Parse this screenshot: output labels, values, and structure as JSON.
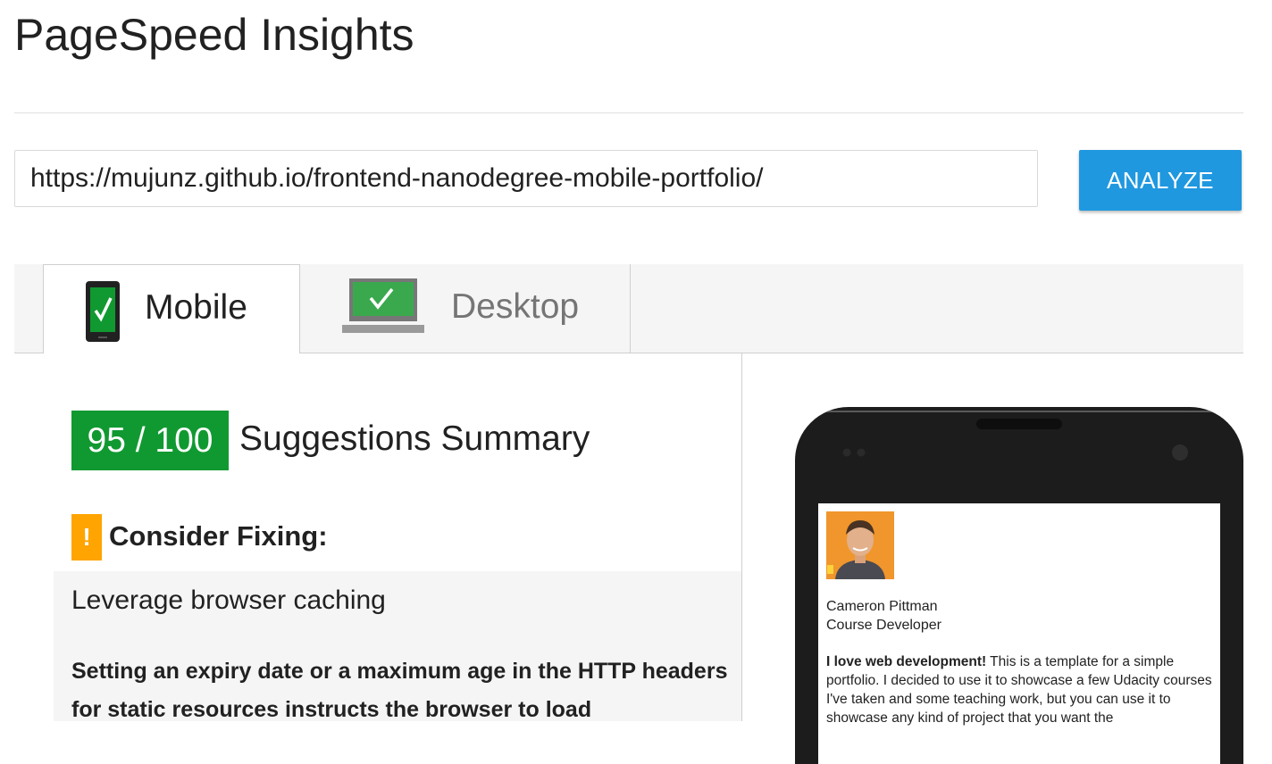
{
  "header": {
    "title": "PageSpeed Insights"
  },
  "search": {
    "url_value": "https://mujunz.github.io/frontend-nanodegree-mobile-portfolio/",
    "analyze_label": "ANALYZE"
  },
  "tabs": [
    {
      "label": "Mobile",
      "icon": "mobile-phone-check-icon",
      "selected": true
    },
    {
      "label": "Desktop",
      "icon": "desktop-monitor-check-icon",
      "selected": false
    }
  ],
  "results": {
    "score": "95 / 100",
    "score_color": "#119931",
    "summary_title": "Suggestions Summary",
    "consider_fixing": {
      "icon": "warning-exclamation-icon",
      "icon_color": "#ffa400",
      "icon_glyph": "!",
      "label": "Consider Fixing:"
    },
    "rule": {
      "title": "Leverage browser caching",
      "description": "Setting an expiry date or a maximum age in the HTTP headers for static resources instructs the browser to load"
    }
  },
  "preview": {
    "name": "Cameron Pittman",
    "role": "Course Developer",
    "intro_bold": "I love web development!",
    "intro_text": " This is a template for a simple portfolio. I decided to use it to showcase a few Udacity courses I've taken and some teaching work, but you can use it to showcase any kind of project that you want the"
  },
  "colors": {
    "accent": "#1f98e0",
    "tab_background": "#f5f5f5"
  }
}
